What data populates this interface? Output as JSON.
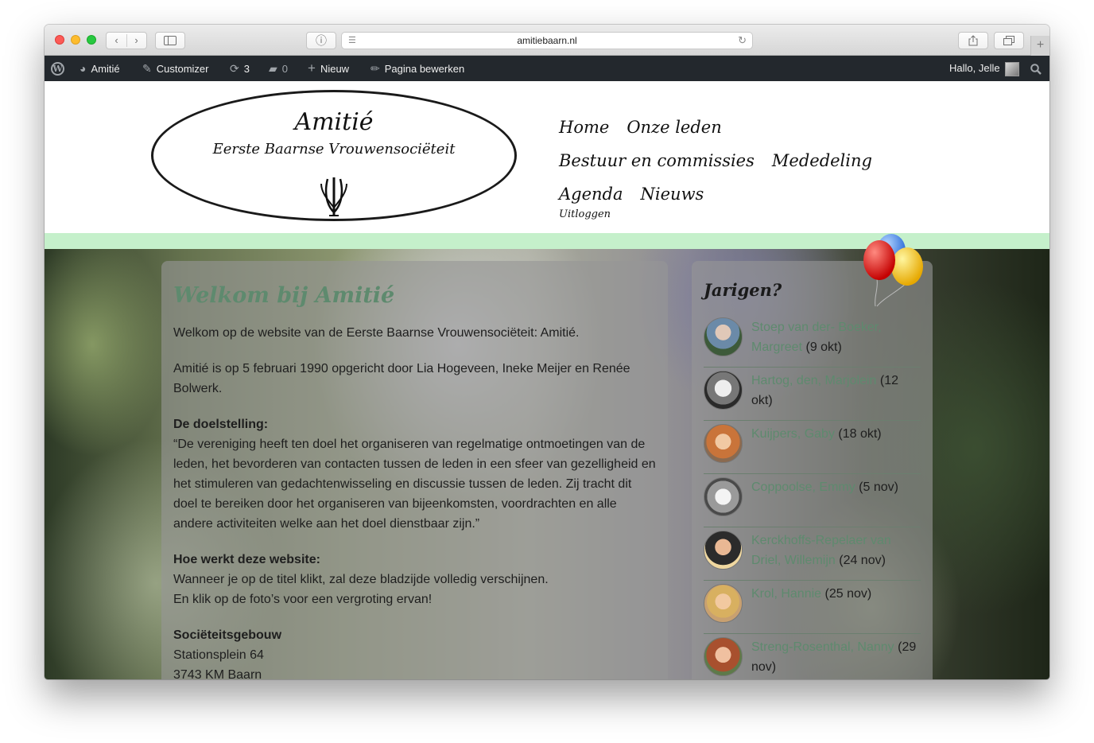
{
  "browser": {
    "url": "amitiebaarn.nl",
    "back_glyph": "‹",
    "forward_glyph": "›",
    "reader_glyph": "ⓘ",
    "reload_glyph": "↻",
    "tab_add_glyph": "+"
  },
  "adminbar": {
    "site_name": "Amitié",
    "customizer": "Customizer",
    "updates_count": "3",
    "comments_count": "0",
    "new_label": "Nieuw",
    "edit_page": "Pagina bewerken",
    "greeting": "Hallo, Jelle"
  },
  "logo": {
    "title": "Amitié",
    "subtitle": "Eerste Baarnse Vrouwensociëteit"
  },
  "nav": {
    "items": [
      "Home",
      "Onze leden",
      "Bestuur en commissies",
      "Mededeling",
      "Agenda",
      "Nieuws"
    ],
    "logout": "Uitloggen"
  },
  "content": {
    "title": "Welkom bij Amitié",
    "intro": "Welkom op de website van de Eerste Baarnse Vrouwensociëteit: Amitié.",
    "founded": "Amitié is op 5 februari 1990 opgericht door Lia Hogeveen, Ineke Meijer en Renée Bolwerk.",
    "goal_heading": "De doelstelling:",
    "goal_text": "“De vereniging heeft ten doel het organiseren van regelmatige ontmoetingen van de leden, het bevorderen van contacten tussen de leden in een sfeer van gezelligheid en het stimuleren van gedachtenwisseling en discussie tussen de leden. Zij tracht dit doel te bereiken door het organiseren van bijeenkomsten, voordrachten en alle andere activiteiten welke aan het doel dienstbaar zijn.”",
    "how_heading": "Hoe werkt deze website:",
    "how_line1": "Wanneer je op de titel klikt, zal deze bladzijde volledig verschijnen.",
    "how_line2": "En klik op de foto’s voor een vergroting ervan!",
    "building_heading": "Sociëteitsgebouw",
    "address_line1": "Stationsplein 64",
    "address_line2": "3743 KM Baarn"
  },
  "birthdays": {
    "title": "Jarigen?",
    "items": [
      {
        "name": "Stoep van der- Boeker, Margreet",
        "date": "(9 okt)"
      },
      {
        "name": "Hartog, den, Marjolein",
        "date": "(12 okt)"
      },
      {
        "name": "Kuijpers, Gaby",
        "date": "(18 okt)"
      },
      {
        "name": "Coppoolse, Emmy",
        "date": "(5 nov)"
      },
      {
        "name": "Kerckhoffs-Repelaer van Driel, Willemijn",
        "date": "(24 nov)"
      },
      {
        "name": "Krol, Hannie",
        "date": "(25 nov)"
      },
      {
        "name": "Streng-Rosenthal, Nanny",
        "date": "(29 nov)"
      }
    ]
  },
  "colors": {
    "accent_green": "#5e8a6e",
    "header_stripe": "#c5f0cb",
    "adminbar_bg": "#23282d"
  }
}
